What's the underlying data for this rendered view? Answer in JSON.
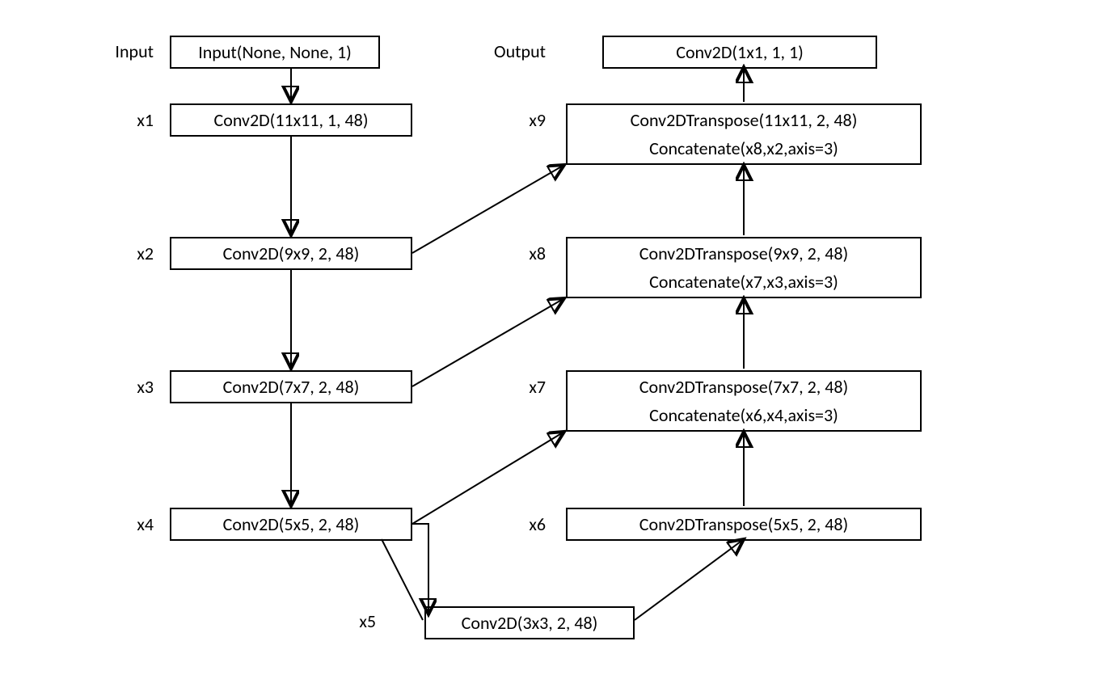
{
  "labels": {
    "input": "Input",
    "output": "Output",
    "x1": "x1",
    "x2": "x2",
    "x3": "x3",
    "x4": "x4",
    "x5": "x5",
    "x6": "x6",
    "x7": "x7",
    "x8": "x8",
    "x9": "x9"
  },
  "boxes": {
    "input": "Input(None, None, 1)",
    "x1": "Conv2D(11x11, 1, 48)",
    "x2": "Conv2D(9x9, 2, 48)",
    "x3": "Conv2D(7x7, 2, 48)",
    "x4": "Conv2D(5x5, 2, 48)",
    "x5": "Conv2D(3x3, 2, 48)",
    "output": "Conv2D(1x1, 1, 1)",
    "x9_top": "Conv2DTranspose(11x11, 2, 48)",
    "x9_bot": "Concatenate(x8,x2,axis=3)",
    "x8_top": "Conv2DTranspose(9x9, 2, 48)",
    "x8_bot": "Concatenate(x7,x3,axis=3)",
    "x7_top": "Conv2DTranspose(7x7, 2, 48)",
    "x7_bot": "Concatenate(x6,x4,axis=3)",
    "x6": "Conv2DTranspose(5x5, 2, 48)"
  }
}
